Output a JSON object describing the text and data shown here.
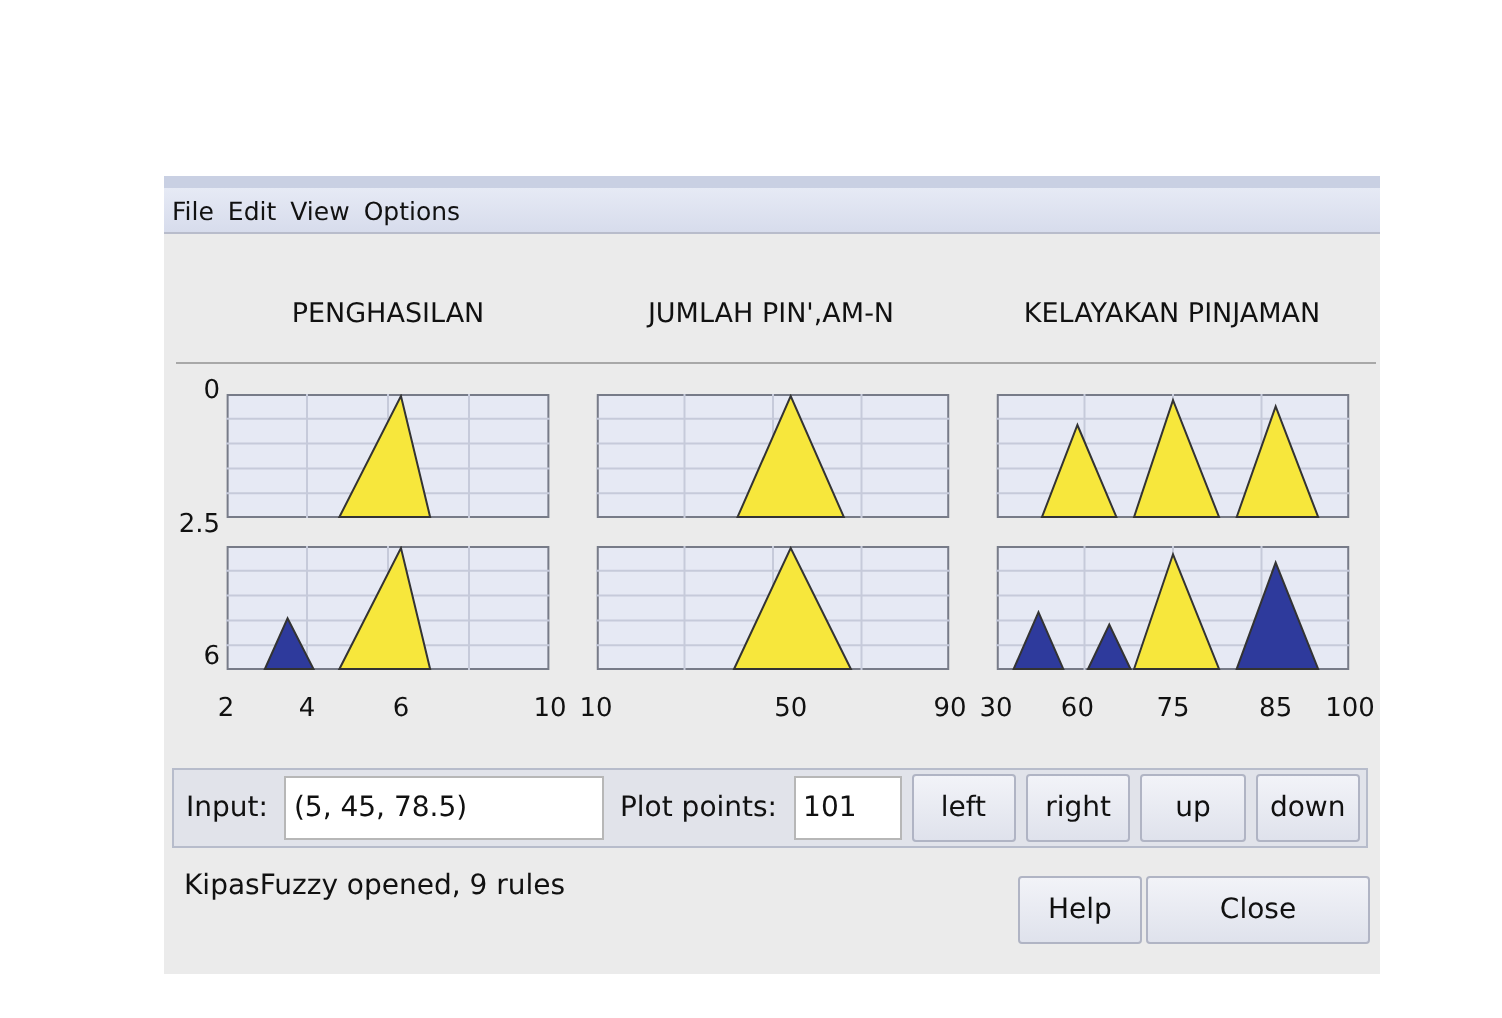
{
  "menu": [
    "File",
    "Edit",
    "View",
    "Options"
  ],
  "columns": [
    {
      "title": "PENGHASILAN",
      "xticks": [
        "2",
        "4",
        "6",
        "10"
      ],
      "plots": [
        {
          "triangles": [
            {
              "color": "#f7e73c"
            }
          ]
        },
        {
          "triangles": [
            {
              "color": "#2e3a9c"
            },
            {
              "color": "#f7e73c"
            }
          ]
        }
      ]
    },
    {
      "title": "JUMLAH PIN',AM-N",
      "xticks": [
        "10",
        "50",
        "90"
      ],
      "plots": [
        {
          "triangles": [
            {
              "color": "#f7e73c"
            }
          ]
        },
        {
          "triangles": [
            {
              "color": "#f7e73c"
            }
          ]
        }
      ]
    },
    {
      "title": "KELAYAKAN PINJAMAN",
      "xticks": [
        "30",
        "60",
        "75",
        "85",
        "100"
      ],
      "plots": [
        {
          "triangles": [
            {
              "color": "#f7e73c"
            },
            {
              "color": "#f7e73c"
            },
            {
              "color": "#f7e73c"
            }
          ]
        },
        {
          "triangles": [
            {
              "color": "#2e3a9c"
            },
            {
              "color": "#2e3a9c"
            },
            {
              "color": "#f7e73c"
            },
            {
              "color": "#2e3a9c"
            }
          ]
        }
      ]
    }
  ],
  "yticks": [
    [
      "0",
      "2.5"
    ],
    [
      "6"
    ]
  ],
  "input": {
    "label": "Input:",
    "value": "(5, 45, 78.5)"
  },
  "plot_points": {
    "label": "Plot points:",
    "value": "101"
  },
  "nav_buttons": [
    "left",
    "right",
    "up",
    "down"
  ],
  "status": "KipasFuzzy opened, 9 rules",
  "buttons": [
    "Help",
    "Close"
  ]
}
